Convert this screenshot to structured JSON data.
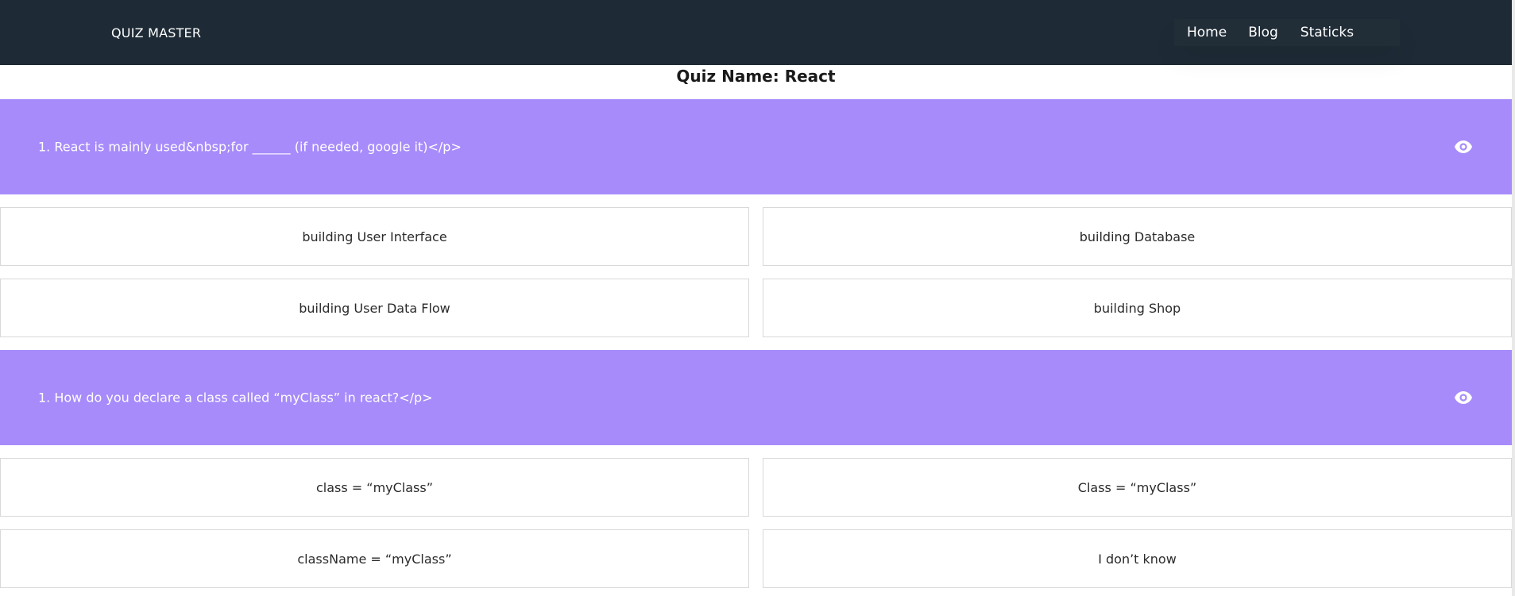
{
  "nav": {
    "brand": "QUIZ MASTER",
    "links": [
      "Home",
      "Blog",
      "Staticks"
    ]
  },
  "quiz": {
    "title": "Quiz Name: React"
  },
  "questions": [
    {
      "text": "1. React is mainly used&nbsp;for ______ (if needed, google it)</p>",
      "options": [
        "building User Interface",
        "building Database",
        "building User Data Flow",
        "building Shop"
      ]
    },
    {
      "text": "1. How do you declare a class called “myClass” in react?</p>",
      "options": [
        "class = “myClass”",
        "Class = “myClass”",
        "className = “myClass”",
        "I don’t know"
      ]
    }
  ],
  "icons": {
    "reveal_answer": "eye-icon"
  },
  "colors": {
    "navbar_bg": "#1e2b36",
    "question_bg": "#a78bfa",
    "option_border": "#d9d9d9",
    "text_light": "#ffffff"
  }
}
